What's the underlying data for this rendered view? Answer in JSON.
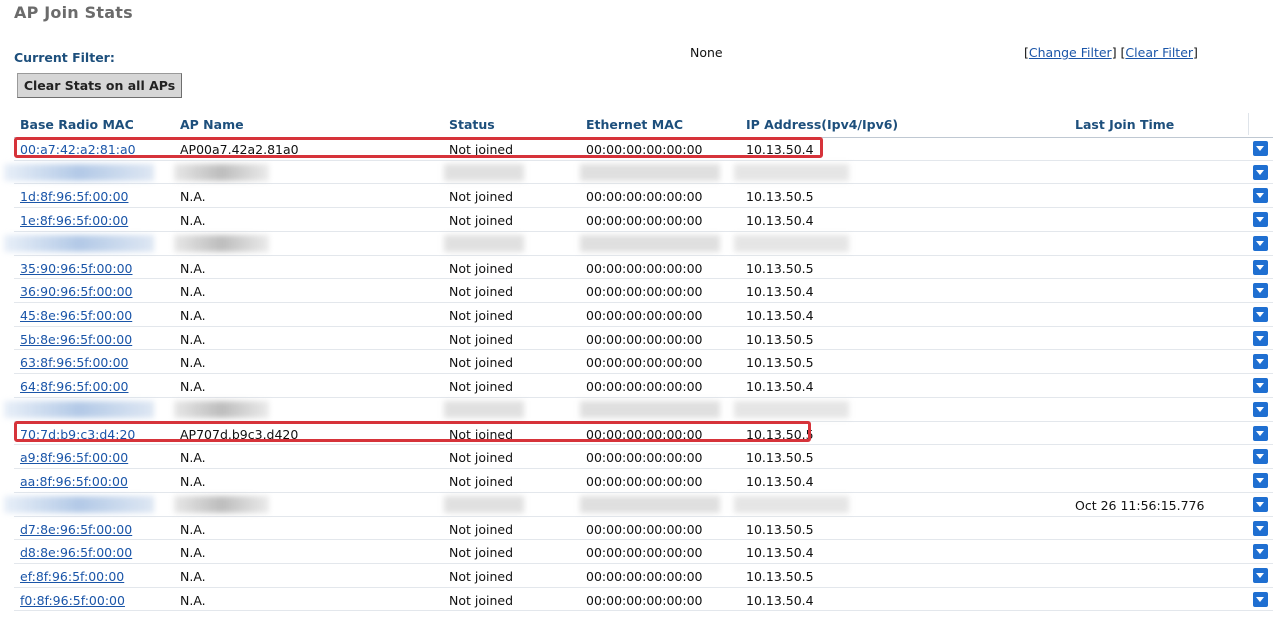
{
  "page": {
    "title": "AP Join Stats"
  },
  "filter": {
    "label": "Current Filter:",
    "value": "None",
    "change_link": "Change Filter",
    "clear_link": "Clear Filter"
  },
  "actions": {
    "clear_stats_label": "Clear Stats on all APs"
  },
  "table": {
    "columns": [
      "Base Radio MAC",
      "AP Name",
      "Status",
      "Ethernet MAC",
      "IP Address(Ipv4/Ipv6)",
      "Last Join Time"
    ],
    "rows": [
      {
        "base_mac": "00:a7:42:a2:81:a0",
        "ap_name": "AP00a7.42a2.81a0",
        "status": "Not joined",
        "eth_mac": "00:00:00:00:00:00",
        "ip": "10.13.50.4",
        "last_join": "",
        "redacted": false,
        "highlighted": true
      },
      {
        "base_mac": "",
        "ap_name": "",
        "status": "",
        "eth_mac": "",
        "ip": "",
        "last_join": "",
        "redacted": true,
        "highlighted": false
      },
      {
        "base_mac": "1d:8f:96:5f:00:00",
        "ap_name": "N.A.",
        "status": "Not joined",
        "eth_mac": "00:00:00:00:00:00",
        "ip": "10.13.50.5",
        "last_join": "",
        "redacted": false,
        "highlighted": false
      },
      {
        "base_mac": "1e:8f:96:5f:00:00",
        "ap_name": "N.A.",
        "status": "Not joined",
        "eth_mac": "00:00:00:00:00:00",
        "ip": "10.13.50.4",
        "last_join": "",
        "redacted": false,
        "highlighted": false
      },
      {
        "base_mac": "",
        "ap_name": "",
        "status": "",
        "eth_mac": "",
        "ip": "",
        "last_join": "",
        "redacted": true,
        "highlighted": false
      },
      {
        "base_mac": "35:90:96:5f:00:00",
        "ap_name": "N.A.",
        "status": "Not joined",
        "eth_mac": "00:00:00:00:00:00",
        "ip": "10.13.50.5",
        "last_join": "",
        "redacted": false,
        "highlighted": false
      },
      {
        "base_mac": "36:90:96:5f:00:00",
        "ap_name": "N.A.",
        "status": "Not joined",
        "eth_mac": "00:00:00:00:00:00",
        "ip": "10.13.50.4",
        "last_join": "",
        "redacted": false,
        "highlighted": false
      },
      {
        "base_mac": "45:8e:96:5f:00:00",
        "ap_name": "N.A.",
        "status": "Not joined",
        "eth_mac": "00:00:00:00:00:00",
        "ip": "10.13.50.4",
        "last_join": "",
        "redacted": false,
        "highlighted": false
      },
      {
        "base_mac": "5b:8e:96:5f:00:00",
        "ap_name": "N.A.",
        "status": "Not joined",
        "eth_mac": "00:00:00:00:00:00",
        "ip": "10.13.50.5",
        "last_join": "",
        "redacted": false,
        "highlighted": false
      },
      {
        "base_mac": "63:8f:96:5f:00:00",
        "ap_name": "N.A.",
        "status": "Not joined",
        "eth_mac": "00:00:00:00:00:00",
        "ip": "10.13.50.5",
        "last_join": "",
        "redacted": false,
        "highlighted": false
      },
      {
        "base_mac": "64:8f:96:5f:00:00",
        "ap_name": "N.A.",
        "status": "Not joined",
        "eth_mac": "00:00:00:00:00:00",
        "ip": "10.13.50.4",
        "last_join": "",
        "redacted": false,
        "highlighted": false
      },
      {
        "base_mac": "",
        "ap_name": "",
        "status": "",
        "eth_mac": "",
        "ip": "",
        "last_join": "",
        "redacted": true,
        "highlighted": false
      },
      {
        "base_mac": "70:7d:b9:c3:d4:20",
        "ap_name": "AP707d.b9c3.d420",
        "status": "Not joined",
        "eth_mac": "00:00:00:00:00:00",
        "ip": "10.13.50.5",
        "last_join": "",
        "redacted": false,
        "highlighted": true
      },
      {
        "base_mac": "a9:8f:96:5f:00:00",
        "ap_name": "N.A.",
        "status": "Not joined",
        "eth_mac": "00:00:00:00:00:00",
        "ip": "10.13.50.5",
        "last_join": "",
        "redacted": false,
        "highlighted": false
      },
      {
        "base_mac": "aa:8f:96:5f:00:00",
        "ap_name": "N.A.",
        "status": "Not joined",
        "eth_mac": "00:00:00:00:00:00",
        "ip": "10.13.50.4",
        "last_join": "",
        "redacted": false,
        "highlighted": false
      },
      {
        "base_mac": "",
        "ap_name": "",
        "status": "",
        "eth_mac": "",
        "ip": "",
        "last_join": "Oct 26 11:56:15.776",
        "redacted": true,
        "highlighted": false
      },
      {
        "base_mac": "d7:8e:96:5f:00:00",
        "ap_name": "N.A.",
        "status": "Not joined",
        "eth_mac": "00:00:00:00:00:00",
        "ip": "10.13.50.5",
        "last_join": "",
        "redacted": false,
        "highlighted": false
      },
      {
        "base_mac": "d8:8e:96:5f:00:00",
        "ap_name": "N.A.",
        "status": "Not joined",
        "eth_mac": "00:00:00:00:00:00",
        "ip": "10.13.50.4",
        "last_join": "",
        "redacted": false,
        "highlighted": false
      },
      {
        "base_mac": "ef:8f:96:5f:00:00",
        "ap_name": "N.A.",
        "status": "Not joined",
        "eth_mac": "00:00:00:00:00:00",
        "ip": "10.13.50.5",
        "last_join": "",
        "redacted": false,
        "highlighted": false
      },
      {
        "base_mac": "f0:8f:96:5f:00:00",
        "ap_name": "N.A.",
        "status": "Not joined",
        "eth_mac": "00:00:00:00:00:00",
        "ip": "10.13.50.4",
        "last_join": "",
        "redacted": false,
        "highlighted": false
      }
    ]
  },
  "icons": {
    "row_action": "chevron-down-icon"
  },
  "colors": {
    "header_text": "#1d4f7c",
    "link": "#1a55a8",
    "dropdown_button": "#1f6fd1",
    "highlight_border": "#d6333a",
    "title": "#6b6b6b"
  }
}
